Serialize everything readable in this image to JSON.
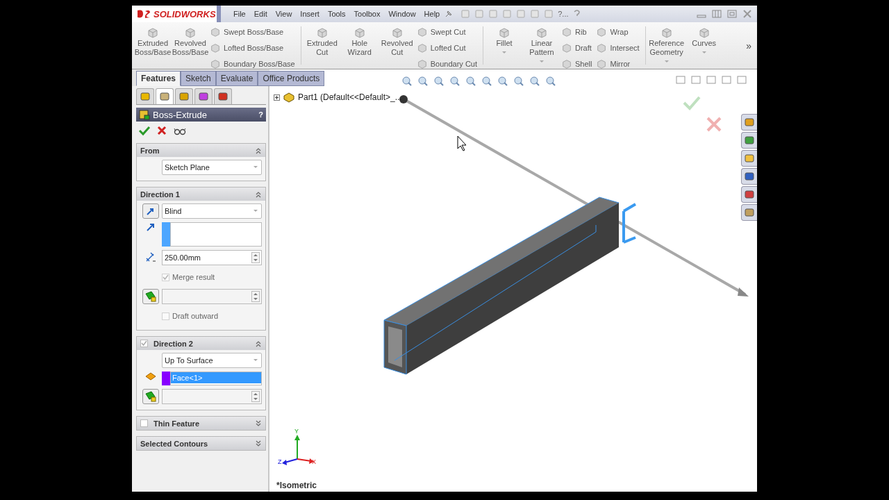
{
  "app": {
    "logo": "SOLIDWORKS"
  },
  "menu": [
    "File",
    "Edit",
    "View",
    "Insert",
    "Tools",
    "Toolbox",
    "Window",
    "Help"
  ],
  "search_hint": "?...",
  "ribbon": {
    "groups": [
      {
        "columns": [
          {
            "kind": "large",
            "label": "Extruded Boss/Base",
            "dropdown": false
          },
          {
            "kind": "large",
            "label": "Revolved Boss/Base",
            "dropdown": false
          },
          {
            "kind": "stack",
            "items": [
              "Swept Boss/Base",
              "Lofted Boss/Base",
              "Boundary Boss/Base"
            ]
          }
        ]
      },
      {
        "columns": [
          {
            "kind": "large",
            "label": "Extruded Cut",
            "dropdown": false
          },
          {
            "kind": "large",
            "label": "Hole Wizard",
            "dropdown": false
          },
          {
            "kind": "large",
            "label": "Revolved Cut",
            "dropdown": false
          },
          {
            "kind": "stack",
            "items": [
              "Swept Cut",
              "Lofted Cut",
              "Boundary Cut"
            ]
          }
        ]
      },
      {
        "columns": [
          {
            "kind": "large",
            "label": "Fillet",
            "dropdown": true
          },
          {
            "kind": "large",
            "label": "Linear Pattern",
            "dropdown": true
          },
          {
            "kind": "stack",
            "items": [
              "Rib",
              "Draft",
              "Shell"
            ]
          },
          {
            "kind": "stack",
            "items": [
              "Wrap",
              "Intersect",
              "Mirror"
            ]
          }
        ]
      },
      {
        "columns": [
          {
            "kind": "large",
            "label": "Reference Geometry",
            "dropdown": true
          },
          {
            "kind": "large",
            "label": "Curves",
            "dropdown": true
          }
        ]
      }
    ],
    "overflow": "»"
  },
  "tabs": [
    {
      "label": "Features",
      "selected": true
    },
    {
      "label": "Sketch",
      "selected": false
    },
    {
      "label": "Evaluate",
      "selected": false
    },
    {
      "label": "Office Products",
      "selected": false
    }
  ],
  "pm_tabs": [
    {
      "selected": false
    },
    {
      "selected": true
    },
    {
      "selected": false
    },
    {
      "selected": false
    },
    {
      "selected": false
    }
  ],
  "pm": {
    "title": "Boss-Extrude",
    "help": "?",
    "sections": [
      {
        "title": "From",
        "expanded": true,
        "rows": [
          {
            "kind": "select",
            "value": "Sketch Plane"
          }
        ]
      },
      {
        "title": "Direction 1",
        "expanded": true,
        "rows": [
          {
            "kind": "select-with-button",
            "value": "Blind"
          },
          {
            "kind": "direction-selection",
            "color": "#4da6ff"
          },
          {
            "kind": "number",
            "value": "250.00mm"
          },
          {
            "kind": "check",
            "label": "Merge result",
            "checked": true,
            "disabled": true
          },
          {
            "kind": "spinner"
          },
          {
            "kind": "check",
            "label": "Draft outward",
            "checked": false,
            "disabled": true
          }
        ]
      },
      {
        "title": "Direction 2",
        "checked": true,
        "expanded": true,
        "rows": [
          {
            "kind": "select",
            "value": "Up To Surface"
          },
          {
            "kind": "face-selection",
            "color": "#8800ff",
            "items": [
              {
                "label": "Face<1>",
                "selected": true
              }
            ]
          },
          {
            "kind": "spinner"
          }
        ]
      },
      {
        "title": "Thin Feature",
        "checked": false,
        "expanded": false
      },
      {
        "title": "Selected Contours",
        "expanded": false
      }
    ]
  },
  "viewport": {
    "tree_label": "Part1  (Default<<Default>_...",
    "triad_labels": [
      "Y",
      "Z",
      "X"
    ],
    "view_label": "*Isometric"
  }
}
